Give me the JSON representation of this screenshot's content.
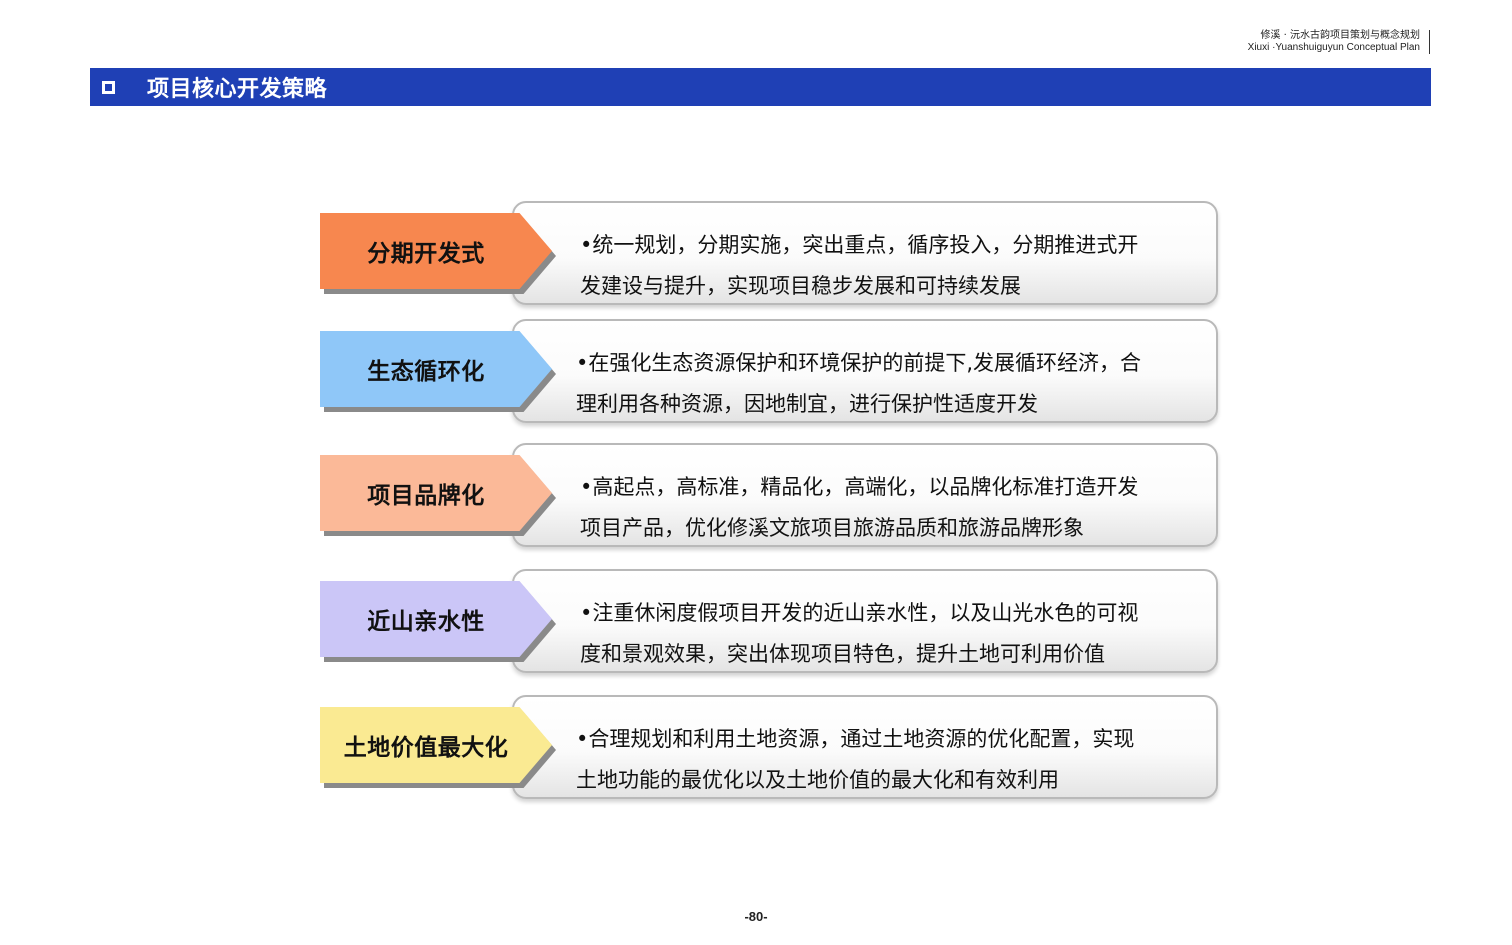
{
  "header": {
    "title_cn": "修溪 · 沅水古韵项目策划与概念规划",
    "title_en": "Xiuxi ·Yuanshuiguyun Conceptual Plan"
  },
  "section": {
    "title": "项目核心开发策略"
  },
  "strategies": [
    {
      "label": "分期开发式",
      "color": "#f7874f",
      "text": "•统一规划，分期实施，突出重点，循序投入，分期推进式开\n  发建设与提升，实现项目稳步发展和可持续发展"
    },
    {
      "label": "生态循环化",
      "color": "#8fc7f8",
      "text": "•在强化生态资源保护和环境保护的前提下,发展循环经济，合\n理利用各种资源，因地制宜，进行保护性适度开发"
    },
    {
      "label": "项目品牌化",
      "color": "#fbb998",
      "text": "•高起点，高标准，精品化，高端化，以品牌化标准打造开发\n  项目产品，优化修溪文旅项目旅游品质和旅游品牌形象"
    },
    {
      "label": "近山亲水性",
      "color": "#cbc6f7",
      "text": "•注重休闲度假项目开发的近山亲水性，以及山光水色的可视\n  度和景观效果，突出体现项目特色，提升土地可利用价值"
    },
    {
      "label": "土地价值最大化",
      "color": "#faea92",
      "text": "•合理规划和利用土地资源，通过土地资源的优化配置，实现\n土地功能的最优化以及土地价值的最大化和有效利用"
    }
  ],
  "footer": {
    "page_number": "-80-"
  }
}
